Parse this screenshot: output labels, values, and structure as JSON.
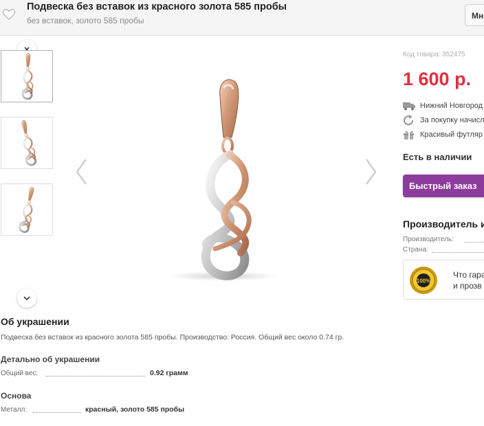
{
  "header": {
    "title": "Подвеска без вставок из красного золота 585 пробы",
    "subtitle": "без вставок, золото 585 пробы",
    "more_button": "Мн"
  },
  "info": {
    "sku": "Код товара: 352475",
    "price": "1 600 р.",
    "features": [
      {
        "icon": "truck-icon",
        "text": "Нижний Новгород"
      },
      {
        "icon": "refresh-icon",
        "text": "За покупку начисл"
      },
      {
        "icon": "gift-icon",
        "text": "Красивый футляр"
      }
    ],
    "stock": "Есть в наличии",
    "quick_order": "Быстрый заказ",
    "manufacturer_title": "Производитель и",
    "manufacturer_label": "Производитель:",
    "country_label": "Страна:",
    "guarantee_line1": "Что гара",
    "guarantee_line2": "и прозв",
    "seal_text": "100%"
  },
  "about": {
    "title": "Об украшении",
    "description": "Подвеска без вставок из красного золота 585 пробы. Производство: Россия. Общий вес около 0.74 гр.",
    "details_title": "Детально об украшении",
    "weight_label": "Общий вес:",
    "weight_value": "0.92 грамм",
    "base_title": "Основа",
    "metal_label": "Металл:",
    "metal_value": "красный, золото 585 пробы"
  },
  "colors": {
    "price": "#e0303f",
    "quick_order_button": "#8e3b9e",
    "rose_gold": "#d9a483",
    "white_gold": "#d4d4d4"
  }
}
